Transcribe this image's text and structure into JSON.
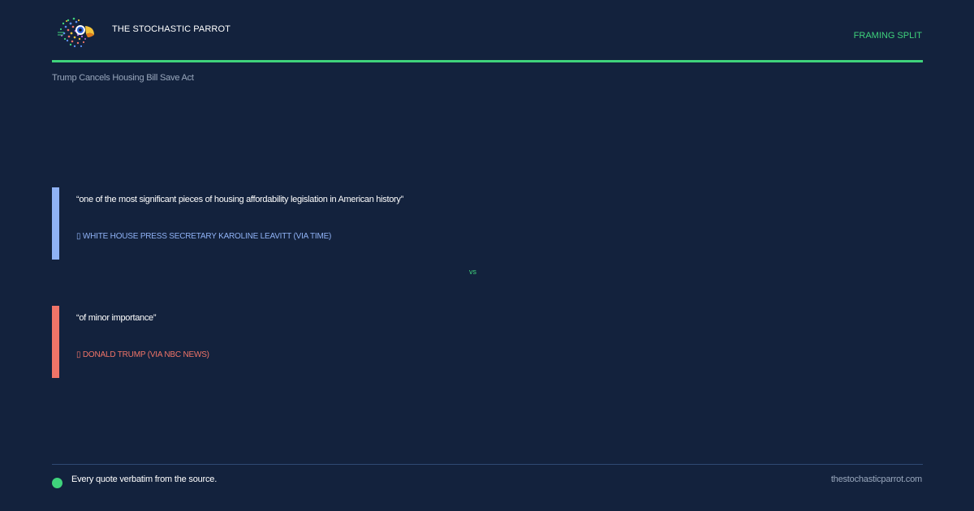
{
  "header": {
    "brand_name": "THE STOCHASTIC PARROT",
    "kicker": "FRAMING SPLIT",
    "logo_icon": "parrot-logo-icon"
  },
  "headline": "Trump Cancels Housing Bill Save Act",
  "quotes": [
    {
      "text": "“one of the most significant pieces of housing affordability legislation in American history”",
      "attribution": "▯ WHITE HOUSE PRESS SECRETARY KAROLINE LEAVITT (VIA TIME)",
      "accent_color": "#8fb2f5"
    },
    {
      "text": "“of minor importance”",
      "attribution": "▯ DONALD TRUMP (VIA NBC NEWS)",
      "accent_color": "#f07468"
    }
  ],
  "divider_label": "vs",
  "footer": {
    "note": "Every quote verbatim from the source.",
    "site": "thestochasticparrot.com"
  },
  "colors": {
    "background": "#13223d",
    "accent": "#3fd37c",
    "muted_text": "#9aa8bd"
  }
}
